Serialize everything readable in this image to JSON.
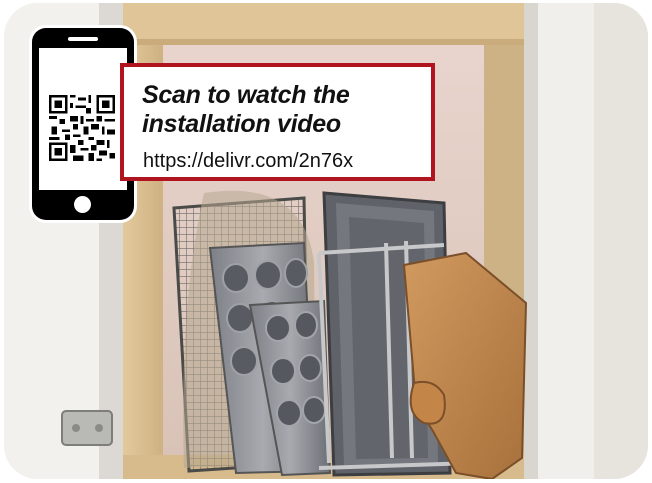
{
  "overlay": {
    "headline_line1": "Scan to watch the",
    "headline_line2": "installation video",
    "url": "https://delivr.com/2n76x",
    "accent_color": "#b0141e"
  },
  "icons": {
    "phone": "smartphone-icon",
    "qr": "qr-code-icon"
  },
  "photo": {
    "subject": "cabinet-with-bakeware-organizer"
  }
}
